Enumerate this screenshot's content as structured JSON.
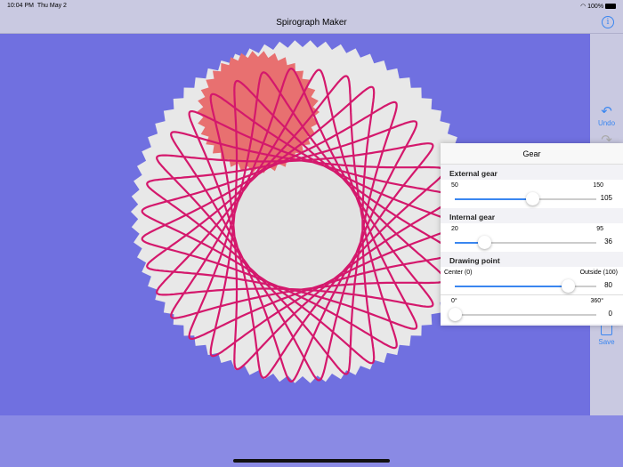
{
  "status": {
    "time": "10:04 PM",
    "date": "Thu May 2",
    "battery": "100%"
  },
  "nav": {
    "title": "Spirograph Maker",
    "info_icon": "i"
  },
  "toolbar": {
    "undo": "Undo",
    "save": "Save"
  },
  "panel": {
    "title": "Gear",
    "external": {
      "label": "External gear",
      "min": "50",
      "max": "150",
      "value": "105",
      "fraction": 0.55
    },
    "internal": {
      "label": "Internal gear",
      "min": "20",
      "max": "95",
      "value": "36",
      "fraction": 0.21
    },
    "drawing": {
      "label": "Drawing point",
      "min": "Center (0)",
      "max": "Outside (100)",
      "value": "80",
      "fraction": 0.8
    },
    "angle": {
      "min": "0°",
      "max": "360°",
      "value": "0",
      "fraction": 0
    }
  },
  "colors": {
    "canvas": "#7070e0",
    "gear": "#e8e8e8",
    "small_gear": "#e87070",
    "pen": "#d4186c",
    "accent": "#3a86f0"
  }
}
